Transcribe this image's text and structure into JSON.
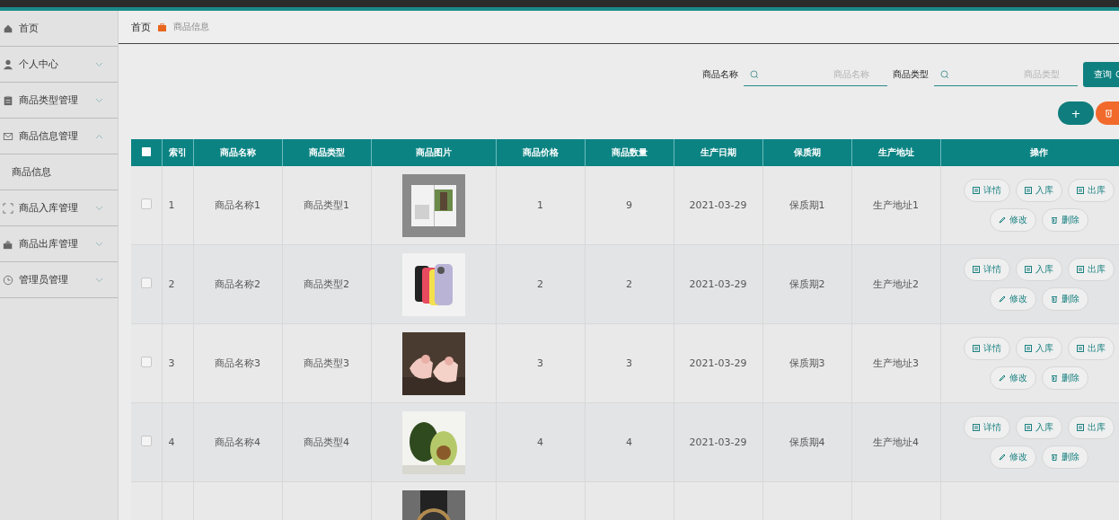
{
  "sidebar": {
    "items": [
      {
        "label": "首页"
      },
      {
        "label": "个人中心",
        "expanded": false
      },
      {
        "label": "商品类型管理",
        "expanded": false
      },
      {
        "label": "商品信息管理",
        "expanded": true,
        "children": [
          {
            "label": "商品信息"
          }
        ]
      },
      {
        "label": "商品入库管理",
        "expanded": false
      },
      {
        "label": "商品出库管理",
        "expanded": false
      },
      {
        "label": "管理员管理",
        "expanded": false
      }
    ]
  },
  "breadcrumb": [
    "首页",
    "商品信息"
  ],
  "search": {
    "fields": [
      {
        "label": "商品名称",
        "placeholder": "商品名称"
      },
      {
        "label": "商品类型",
        "placeholder": "商品类型"
      }
    ],
    "button": "查询"
  },
  "add_button": "+",
  "table": {
    "header_checked": false,
    "columns": [
      "索引",
      "商品名称",
      "商品类型",
      "商品图片",
      "商品价格",
      "商品数量",
      "生产日期",
      "保质期",
      "生产地址",
      "操作"
    ],
    "rows": [
      {
        "checked": false,
        "cells": [
          "1",
          "商品名称1",
          "商品类型1",
          null,
          "1",
          "9",
          "2021-03-29",
          "保质期1",
          "生产地址1"
        ],
        "image": {
          "kind": "picture"
        },
        "actions": [
          "详情",
          "入库",
          "出库",
          "修改",
          "删除"
        ]
      },
      {
        "checked": false,
        "cells": [
          "2",
          "商品名称2",
          "商品类型2",
          null,
          "2",
          "2",
          "2021-03-29",
          "保质期2",
          "生产地址2"
        ],
        "image": {
          "kind": "picture"
        },
        "actions": [
          "详情",
          "入库",
          "出库",
          "修改",
          "删除"
        ]
      },
      {
        "checked": false,
        "cells": [
          "3",
          "商品名称3",
          "商品类型3",
          null,
          "3",
          "3",
          "2021-03-29",
          "保质期3",
          "生产地址3"
        ],
        "image": {
          "kind": "picture"
        },
        "actions": [
          "详情",
          "入库",
          "出库",
          "修改",
          "删除"
        ]
      },
      {
        "checked": false,
        "cells": [
          "4",
          "商品名称4",
          "商品类型4",
          null,
          "4",
          "4",
          "2021-03-29",
          "保质期4",
          "生产地址4"
        ],
        "image": {
          "kind": "picture"
        },
        "actions": [
          "详情",
          "入库",
          "出库",
          "修改",
          "删除"
        ]
      },
      {
        "image": {
          "kind": "picture"
        }
      }
    ]
  }
}
